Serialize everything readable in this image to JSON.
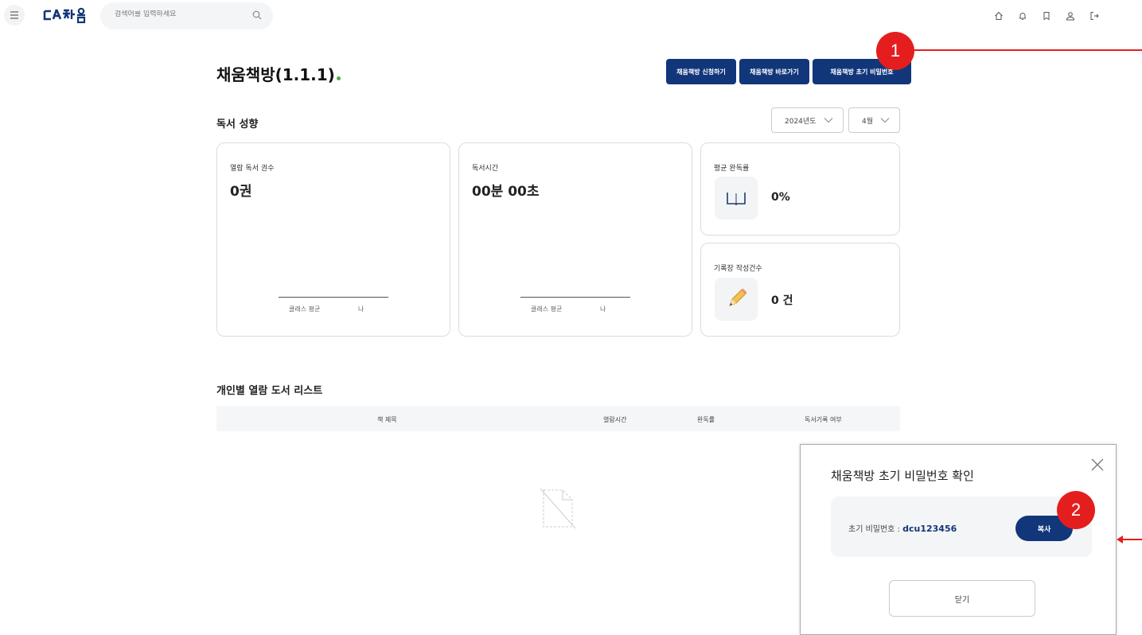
{
  "header": {
    "search_placeholder": "검색어를 입력하세요",
    "icons": [
      "home-icon",
      "bell-icon",
      "bookmark-icon",
      "user-icon",
      "logout-icon"
    ]
  },
  "page": {
    "title": "채움책방(1.1.1)",
    "buttons": {
      "apply": "채움책방 신청하기",
      "goto": "채움책방 바로가기",
      "reset_pw": "채움책방 초기 비밀번호"
    }
  },
  "reading": {
    "section_title": "독서 성향",
    "year": "2024년도",
    "month": "4월",
    "books_label": "열람 독서 권수",
    "books_value": "0권",
    "time_label": "독서시간",
    "time_value": "00분 00초",
    "legend_class": "클래스 평균",
    "legend_me": "나",
    "completion_label": "평균 완독률",
    "completion_value": "0%",
    "records_label": "기록장 작성건수",
    "records_value": "0 건"
  },
  "list": {
    "section_title": "개인별 열람 도서 리스트",
    "columns": [
      "책 제목",
      "열람시간",
      "완독률",
      "독서기록 여부"
    ]
  },
  "modal": {
    "title": "채움책방 초기 비밀번호 확인",
    "pw_label": "초기 비밀번호 : ",
    "pw_value": "dcu123456",
    "copy": "복사",
    "close": "닫기"
  },
  "annotations": {
    "badge1": "1",
    "badge2": "2"
  },
  "colors": {
    "navy": "#12367a",
    "red_annotation": "#e41e1e",
    "title_dot": "#4caf50"
  }
}
